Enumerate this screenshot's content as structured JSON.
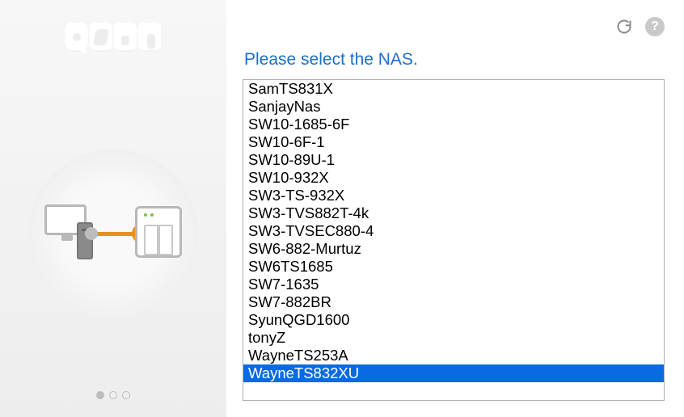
{
  "brand": "QNAP",
  "prompt": "Please select the NAS.",
  "pager": {
    "count": 3,
    "activeIndex": 0
  },
  "topbar": {
    "refresh": "refresh",
    "help": "?"
  },
  "nas_list": {
    "selectedIndex": 16,
    "items": [
      "SamTS831X",
      "SanjayNas",
      "SW10-1685-6F",
      "SW10-6F-1",
      "SW10-89U-1",
      "SW10-932X",
      "SW3-TS-932X",
      "SW3-TVS882T-4k",
      "SW3-TVSEC880-4",
      "SW6-882-Murtuz",
      "SW6TS1685",
      "SW7-1635",
      "SW7-882BR",
      "SyunQGD1600",
      "tonyZ",
      "WayneTS253A",
      "WayneTS832XU"
    ]
  }
}
